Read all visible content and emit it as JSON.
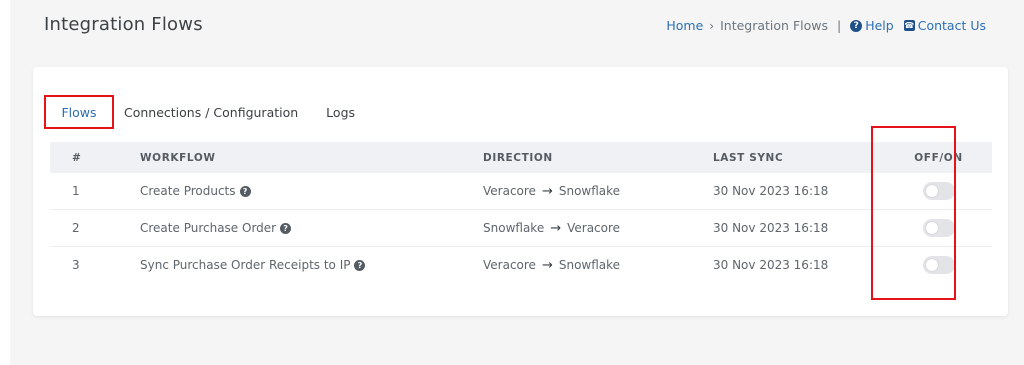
{
  "header": {
    "title": "Integration Flows",
    "breadcrumb": {
      "home": "Home",
      "separator": "›",
      "current": "Integration Flows",
      "pipe": "|",
      "help_label": "Help",
      "contact_label": "Contact Us"
    }
  },
  "tabs": [
    {
      "label": "Flows",
      "active": true
    },
    {
      "label": "Connections / Configuration",
      "active": false
    },
    {
      "label": "Logs",
      "active": false
    }
  ],
  "table": {
    "columns": [
      "#",
      "WORKFLOW",
      "DIRECTION",
      "LAST SYNC",
      "OFF/ON"
    ],
    "rows": [
      {
        "num": "1",
        "workflow": "Create Products",
        "from": "Veracore",
        "to": "Snowflake",
        "last_sync": "30 Nov 2023 16:18",
        "enabled": false
      },
      {
        "num": "2",
        "workflow": "Create Purchase Order",
        "from": "Snowflake",
        "to": "Veracore",
        "last_sync": "30 Nov 2023 16:18",
        "enabled": false
      },
      {
        "num": "3",
        "workflow": "Sync Purchase Order Receipts to IP",
        "from": "Veracore",
        "to": "Snowflake",
        "last_sync": "30 Nov 2023 16:18",
        "enabled": false
      }
    ]
  },
  "colors": {
    "link": "#2c6fb3",
    "highlight": "#e5121a",
    "icon_dark_blue": "#1f4f88"
  },
  "icons": {
    "help": "question-circle-icon",
    "contact": "phone-square-icon",
    "info": "question-circle-icon",
    "arrow": "arrow-right-icon"
  },
  "glyphs": {
    "q": "?",
    "phone": "☎",
    "arrow": "→"
  }
}
